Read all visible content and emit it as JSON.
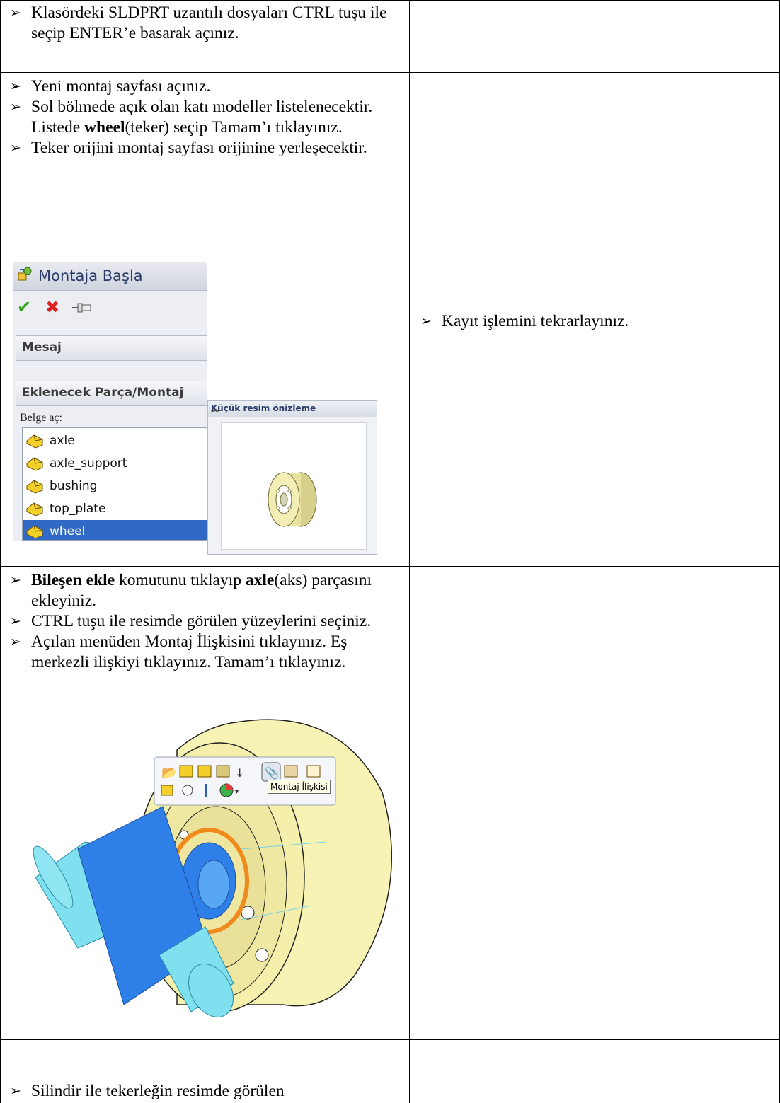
{
  "row1": {
    "left_steps": [
      {
        "text": "Klasördeki SLDPRT uzantılı dosyaları CTRL tuşu ile seçip ENTER’e basarak açınız."
      }
    ],
    "right_steps": []
  },
  "row2": {
    "left_steps": [
      {
        "text": "Yeni montaj sayfası açınız."
      },
      {
        "pre": "Sol bölmede açık olan katı modeller listelenecektir. Listede ",
        "bold": "wheel",
        "post": "(teker) seçip Tamam’ı tıklayınız."
      },
      {
        "text": "Teker orijini montaj sayfası orijinine yerleşecektir."
      }
    ],
    "right_steps": [
      {
        "text": "Kayıt işlemini tekrarlayınız."
      }
    ],
    "panel": {
      "title": "Montaja Başla",
      "group_message": "Mesaj",
      "group_add": "Eklenecek Parça/Montaj",
      "open_doc_label": "Belge aç:",
      "files": [
        "axle",
        "axle_support",
        "bushing",
        "top_plate",
        "wheel"
      ],
      "selected_file": "wheel",
      "thumbnail_title": "Küçük resim önizleme"
    }
  },
  "row3": {
    "left_steps": [
      {
        "bold": "Bileşen ekle",
        "mid": " komutunu tıklayıp ",
        "bold2": "axle",
        "post": "(aks) parçasını ekleyiniz."
      },
      {
        "text": "CTRL tuşu ile resimde görülen yüzeylerini seçiniz."
      },
      {
        "text": "Açılan menüden Montaj İlişkisini tıklayınız. Eş merkezli ilişkiyi tıklayınız. Tamam’ı tıklayınız."
      }
    ],
    "tooltip": "Montaj İlişkisi"
  },
  "row4": {
    "left_steps": [
      {
        "text": "Silindir ile tekerleğin resimde görülen"
      }
    ]
  },
  "colors": {
    "selected_row": "#3169c6",
    "wheel_body": "#f7f3b4",
    "axle": "#7fe0ef",
    "axle_selected": "#2f7fe8",
    "selection_orange": "#f08a1c"
  }
}
